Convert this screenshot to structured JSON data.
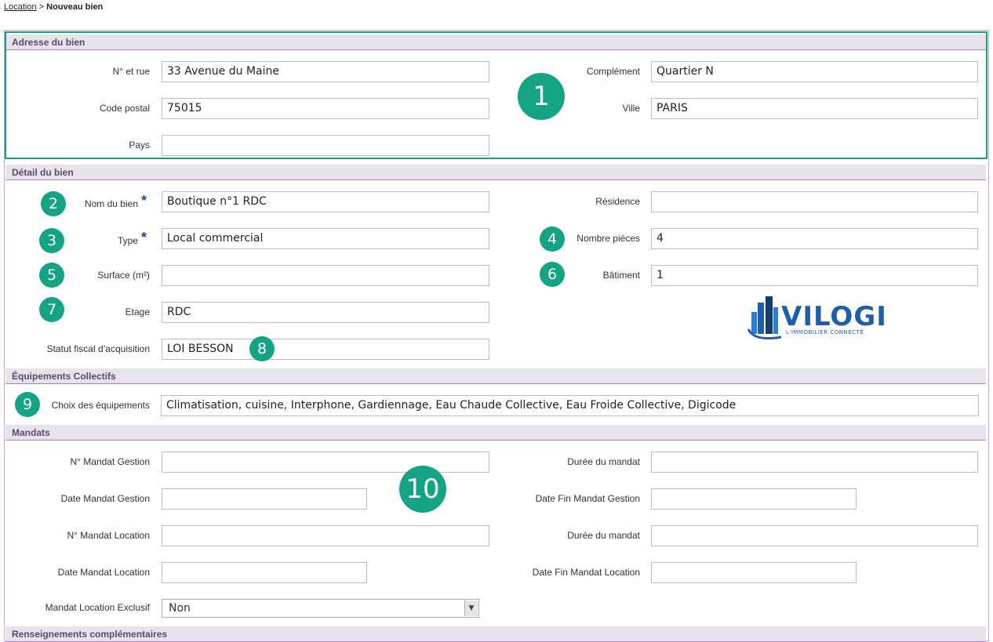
{
  "breadcrumb": {
    "link": "Location",
    "separator": ">",
    "current": "Nouveau bien"
  },
  "sections": {
    "adresse": "Adresse du bien",
    "detail": "Détail du bien",
    "equipements": "Équipements Collectifs",
    "mandats": "Mandats",
    "renseignements": "Renseignements complémentaires"
  },
  "adresse": {
    "rue_label": "N° et rue",
    "rue_value": "33 Avenue du Maine",
    "complement_label": "Complément",
    "complement_value": "Quartier N",
    "cp_label": "Code postal",
    "cp_value": "75015",
    "ville_label": "Ville",
    "ville_value": "PARIS",
    "pays_label": "Pays",
    "pays_value": ""
  },
  "detail": {
    "nom_label": "Nom du bien",
    "nom_value": "Boutique n°1 RDC",
    "residence_label": "Résidence",
    "residence_value": "",
    "type_label": "Type",
    "type_value": "Local commercial",
    "pieces_label": "Nombre pièces",
    "pieces_value": "4",
    "surface_label": "Surface (m²)",
    "surface_value": "",
    "batiment_label": "Bâtiment",
    "batiment_value": "1",
    "etage_label": "Etage",
    "etage_value": "RDC",
    "statut_label": "Statut fiscal d’acquisition",
    "statut_value": "LOI BESSON",
    "required_mark": "*"
  },
  "equipements": {
    "label": "Choix des équipements",
    "value": "Climatisation, cuisine, Interphone, Gardiennage, Eau Chaude Collective, Eau Froide Collective, Digicode"
  },
  "mandats": {
    "num_gestion_label": "N° Mandat Gestion",
    "num_gestion_value": "",
    "duree1_label": "Durée du mandat",
    "duree1_value": "",
    "date_gestion_label": "Date Mandat Gestion",
    "date_gestion_value": "",
    "fin_gestion_label": "Date Fin Mandat Gestion",
    "fin_gestion_value": "",
    "num_location_label": "N° Mandat Location",
    "num_location_value": "",
    "duree2_label": "Durée du mandat",
    "duree2_value": "",
    "date_location_label": "Date Mandat Location",
    "date_location_value": "",
    "fin_location_label": "Date Fin Mandat Location",
    "fin_location_value": "",
    "exclusif_label": "Mandat Location Exclusif",
    "exclusif_value": "Non"
  },
  "badges": [
    "1",
    "2",
    "3",
    "4",
    "5",
    "6",
    "7",
    "8",
    "9",
    "10"
  ],
  "logo": {
    "name": "VILOGI",
    "tagline": "L'IMMOBILIER CONNECTÉ"
  },
  "colors": {
    "badge": "#14a383",
    "section_bg": "#e6e3eb",
    "section_line": "#b07cc9",
    "logo": "#1f5ea8"
  }
}
